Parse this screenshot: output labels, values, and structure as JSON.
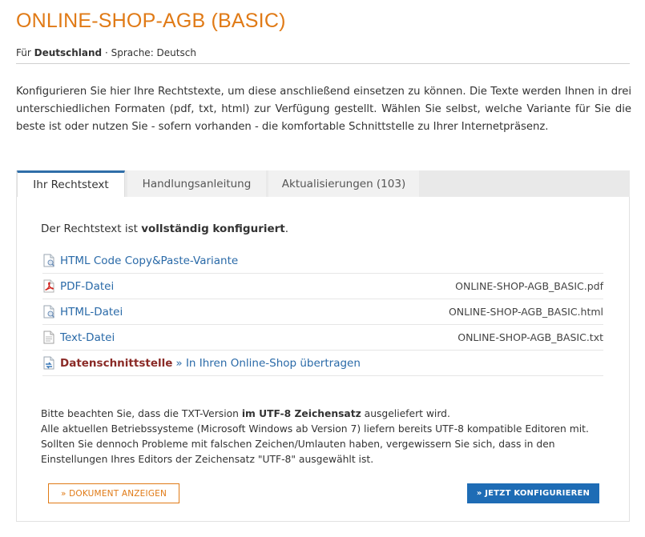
{
  "header": {
    "title": "ONLINE-SHOP-AGB (BASIC)",
    "subtitle_prefix": "Für ",
    "country": "Deutschland",
    "subtitle_suffix": " · Sprache: Deutsch"
  },
  "intro": "Konfigurieren Sie hier Ihre Rechtstexte, um diese anschließend einsetzen zu können. Die Texte werden Ihnen in drei unterschiedlichen Formaten (pdf, txt, html) zur Verfügung gestellt. Wählen Sie selbst, welche Variante für Sie die beste ist oder nutzen Sie - sofern vorhanden - die komfortable Schnittstelle zu Ihrer Internetpräsenz.",
  "tabs": [
    {
      "label": "Ihr Rechtstext",
      "active": true
    },
    {
      "label": "Handlungsanleitung",
      "active": false
    },
    {
      "label": "Aktualisierungen (103)",
      "active": false
    }
  ],
  "status": {
    "prefix": "Der Rechtstext ist ",
    "strong": "vollständig konfiguriert",
    "suffix": "."
  },
  "files": [
    {
      "icon": "html-file-icon",
      "label": "HTML Code Copy&Paste-Variante",
      "filename": ""
    },
    {
      "icon": "pdf-file-icon",
      "label": "PDF-Datei",
      "filename": "ONLINE-SHOP-AGB_BASIC.pdf"
    },
    {
      "icon": "html-file-icon",
      "label": "HTML-Datei",
      "filename": "ONLINE-SHOP-AGB_BASIC.html"
    },
    {
      "icon": "text-file-icon",
      "label": "Text-Datei",
      "filename": "ONLINE-SHOP-AGB_BASIC.txt"
    }
  ],
  "interface": {
    "icon": "interface-icon",
    "label": "Datenschnittstelle",
    "link": "» In Ihren Online-Shop übertragen"
  },
  "note": {
    "line1_prefix": "Bitte beachten Sie, dass die TXT-Version ",
    "line1_strong": "im UTF-8 Zeichensatz",
    "line1_suffix": " ausgeliefert wird.",
    "body": "Alle aktuellen Betriebssysteme (Microsoft Windows ab Version 7) liefern bereits UTF-8 kompatible Editoren mit. Sollten Sie dennoch Probleme mit falschen Zeichen/Umlauten haben, vergewissern Sie sich, dass in den Einstellungen Ihres Editors der Zeichensatz \"UTF-8\" ausgewählt ist."
  },
  "buttons": {
    "show_document": "» DOKUMENT ANZEIGEN",
    "configure_now": "» JETZT KONFIGURIEREN"
  },
  "colors": {
    "accent": "#e07a16",
    "link": "#2a6aa8",
    "primary": "#1e6cb5",
    "interface_label": "#8a2a26"
  }
}
